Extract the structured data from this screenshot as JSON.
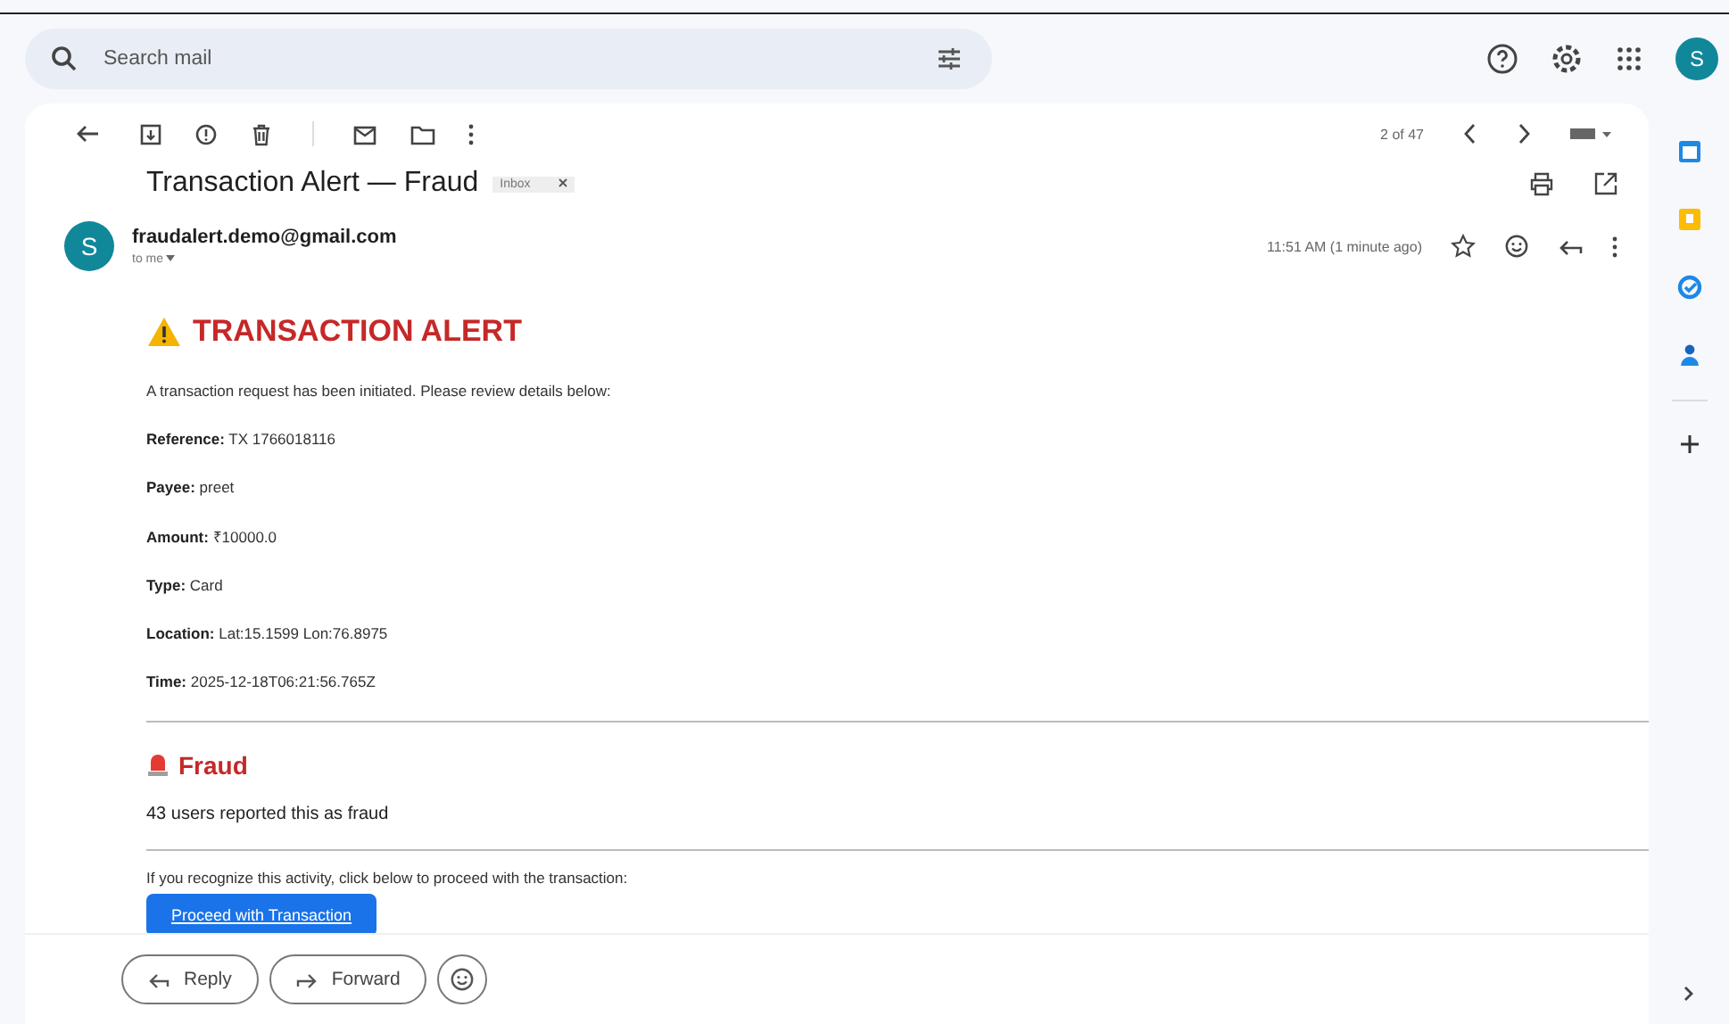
{
  "search": {
    "placeholder": "Search mail"
  },
  "account": {
    "initial": "S"
  },
  "toolbar": {
    "position": "2 of 47"
  },
  "message": {
    "subject": "Transaction Alert — Fraud",
    "label": "Inbox",
    "sender": "fraudalert.demo@gmail.com",
    "sender_initial": "S",
    "recipient": "to me",
    "time": "11:51 AM (1 minute ago)"
  },
  "body": {
    "heading": "TRANSACTION ALERT",
    "intro": "A transaction request has been initiated. Please review details below:",
    "details": [
      {
        "label": "Reference:",
        "value": "TX 1766018116"
      },
      {
        "label": "Payee:",
        "value": "preet"
      },
      {
        "label": "Amount:",
        "value": "₹10000.0"
      },
      {
        "label": "Type:",
        "value": "Card"
      },
      {
        "label": "Location:",
        "value": "Lat:15.1599 Lon:76.8975"
      },
      {
        "label": "Time:",
        "value": "2025-12-18T06:21:56.765Z"
      }
    ],
    "fraud_heading": "Fraud",
    "fraud_text": "43 users reported this as fraud",
    "footer_text": "If you recognize this activity, click below to proceed with the transaction:",
    "action": "Proceed with Transaction"
  },
  "reply_bar": {
    "buttons": [
      "Reply",
      "Forward"
    ]
  }
}
